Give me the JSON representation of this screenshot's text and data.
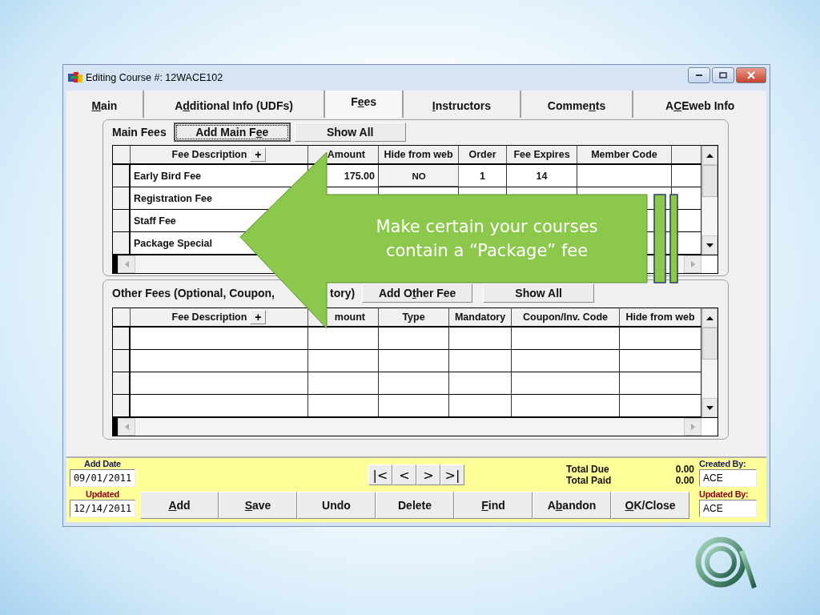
{
  "window": {
    "title": "Editing Course #: 12WACE102"
  },
  "tabs": [
    {
      "key": "M",
      "after": "ain",
      "selected": false
    },
    {
      "before": "A",
      "key": "d",
      "after": "ditional Info (UDFs)",
      "selected": false
    },
    {
      "before": "F",
      "key": "e",
      "after": "es",
      "selected": true
    },
    {
      "key": "I",
      "after": "nstructors",
      "selected": false
    },
    {
      "before": "Comme",
      "key": "n",
      "after": "ts",
      "selected": false
    },
    {
      "before": "A",
      "key": "C",
      "after": "Eweb Info",
      "selected": false
    }
  ],
  "main_fees": {
    "label": "Main Fees",
    "buttons": [
      {
        "before": "Add Main F",
        "key": "e",
        "after": "e",
        "focused": true
      },
      {
        "before": "Show All",
        "focused": false
      }
    ],
    "columns": [
      {
        "label": "Fee Description",
        "button": "+"
      },
      {
        "label": "Amount"
      },
      {
        "label": "Hide from web"
      },
      {
        "label": "Order"
      },
      {
        "label": "Fee Expires"
      },
      {
        "label": "Member Code"
      }
    ],
    "rows": [
      [
        "Early Bird Fee",
        "175.00",
        "NO",
        "1",
        "14"
      ],
      [
        "Registration Fee"
      ],
      [
        "Staff Fee"
      ],
      [
        "Package Special"
      ]
    ]
  },
  "other_fees": {
    "label_parts": [
      "Other Fees (Optional, Coupon,",
      "tory)"
    ],
    "buttons": [
      {
        "before": "Add O",
        "key": "t",
        "after": "her Fee",
        "focused": false
      },
      {
        "before": "Show All",
        "focused": false
      }
    ],
    "columns": [
      {
        "label": "Fee Description",
        "button": "+"
      },
      {
        "label": "mount"
      },
      {
        "label": "Type"
      },
      {
        "label": "Mandatory"
      },
      {
        "label": "Coupon/Inv. Code"
      },
      {
        "label": "Hide from web"
      }
    ]
  },
  "footer": {
    "add_date": {
      "label": "Add Date",
      "value": "09/01/2011"
    },
    "updated": {
      "label": "Updated",
      "value": "12/14/2011"
    },
    "nav": [
      "|<",
      "<",
      ">",
      ">|"
    ],
    "totals": [
      {
        "label": "Total Due",
        "value": "0.00"
      },
      {
        "label": "Total Paid",
        "value": "0.00"
      }
    ],
    "actions": [
      {
        "key": "A",
        "after": "dd"
      },
      {
        "key": "S",
        "after": "ave"
      },
      {
        "before": "Undo"
      },
      {
        "before": "Delete"
      },
      {
        "key": "F",
        "after": "ind"
      },
      {
        "before": "A",
        "key": "b",
        "after": "andon"
      },
      {
        "key": "O",
        "after": "K/Close"
      }
    ],
    "created_by": {
      "label": "Created By:",
      "value": "ACE"
    },
    "updated_by": {
      "label": "Updated By:",
      "value": "ACE"
    }
  },
  "callout": {
    "lines": [
      "Make certain your courses",
      "contain a “Package” fee"
    ]
  }
}
